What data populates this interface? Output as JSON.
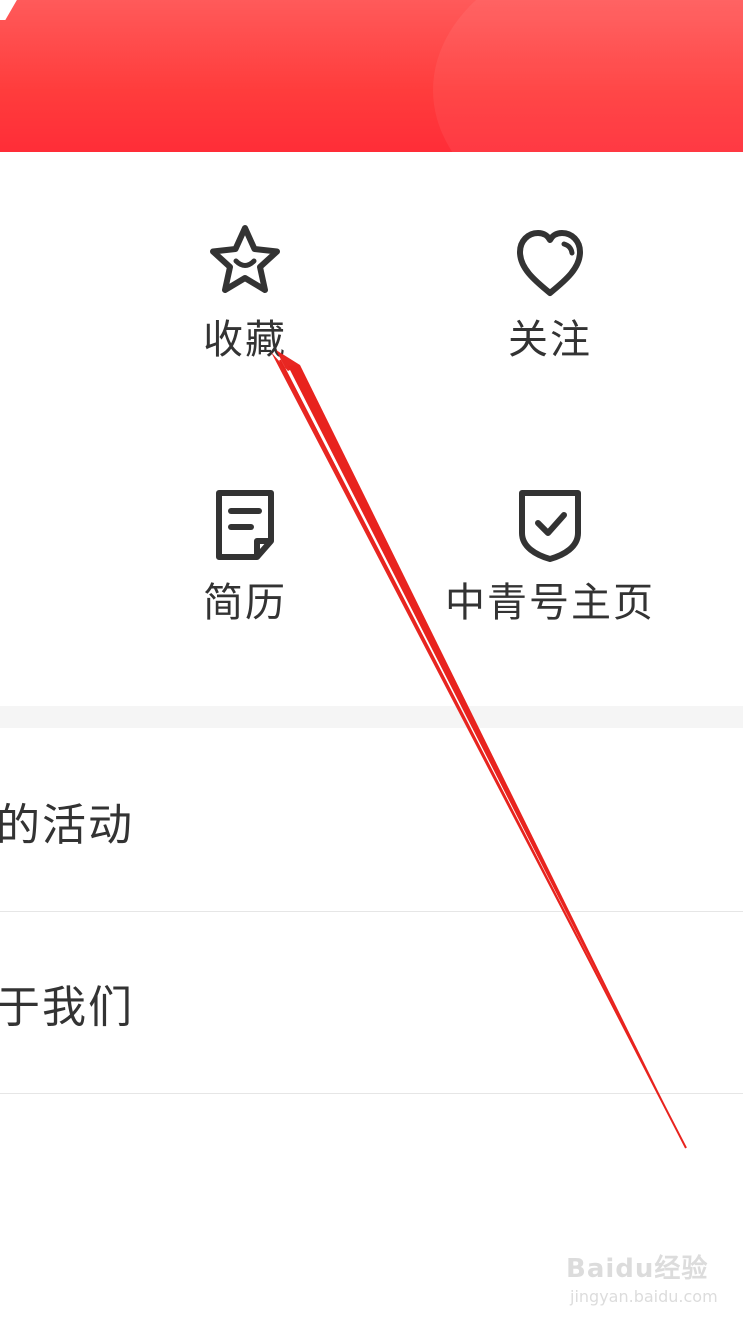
{
  "header": {
    "background": "#ff3c3c"
  },
  "shortcuts": [
    {
      "label": "收藏",
      "icon": "star-smile-icon"
    },
    {
      "label": "关注",
      "icon": "heart-icon"
    },
    {
      "label": "简历",
      "icon": "document-icon"
    },
    {
      "label": "中青号主页",
      "icon": "shield-check-icon"
    }
  ],
  "menu": [
    {
      "label": "的活动"
    },
    {
      "label": "于我们"
    }
  ],
  "watermark": {
    "brand": "Baidu经验",
    "url": "jingyan.baidu.com"
  },
  "colors": {
    "accent_red": "#ff2d38",
    "text": "#333333",
    "divider": "#e6e6e6",
    "annotation_arrow": "#e8231e"
  }
}
